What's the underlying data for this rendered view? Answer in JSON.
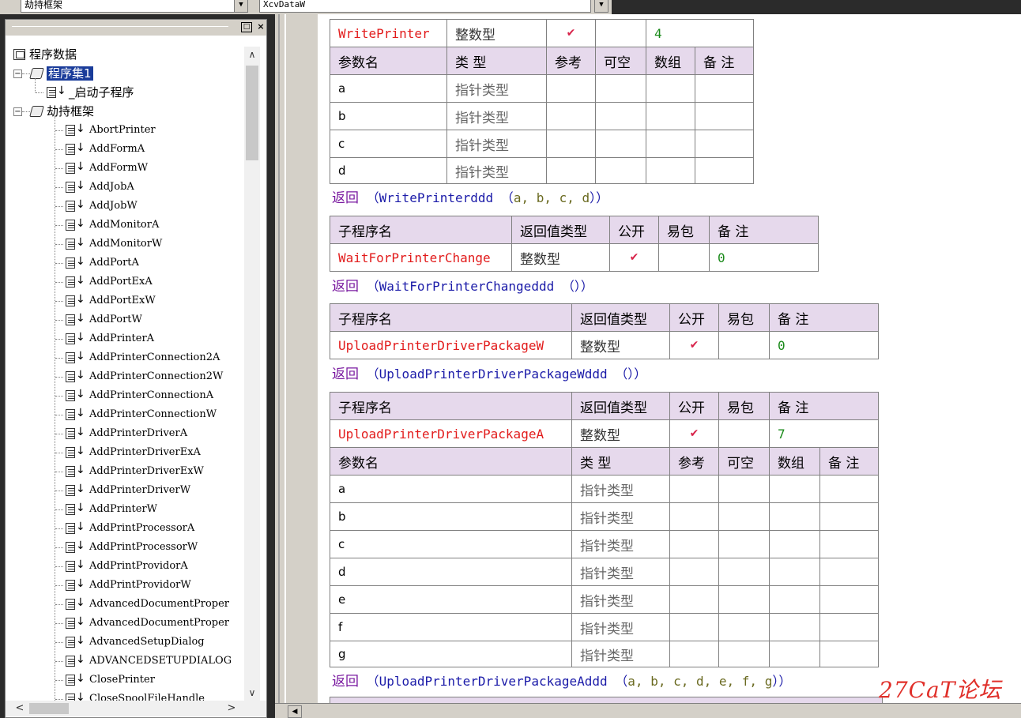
{
  "topbar": {
    "module_combo": "劫持框架",
    "sub_combo": "XcvDataW"
  },
  "tree": {
    "root": "程序数据",
    "set1": "程序集1",
    "set1_child": "_启动子程序",
    "module": "劫持框架",
    "items": [
      "AbortPrinter",
      "AddFormA",
      "AddFormW",
      "AddJobA",
      "AddJobW",
      "AddMonitorA",
      "AddMonitorW",
      "AddPortA",
      "AddPortExA",
      "AddPortExW",
      "AddPortW",
      "AddPrinterA",
      "AddPrinterConnection2A",
      "AddPrinterConnection2W",
      "AddPrinterConnectionA",
      "AddPrinterConnectionW",
      "AddPrinterDriverA",
      "AddPrinterDriverExA",
      "AddPrinterDriverExW",
      "AddPrinterDriverW",
      "AddPrinterW",
      "AddPrintProcessorA",
      "AddPrintProcessorW",
      "AddPrintProvidorA",
      "AddPrintProvidorW",
      "AdvancedDocumentProper",
      "AdvancedDocumentProper",
      "AdvancedSetupDialog",
      "ADVANCEDSETUPDIALOG",
      "ClosePrinter",
      "CloseSpoolFileHandle"
    ]
  },
  "headers": {
    "sub_name": "子程序名",
    "ret_type": "返回值类型",
    "public": "公开",
    "easy_pack": "易包",
    "note": "备 注",
    "param_name": "参数名",
    "type": "类 型",
    "ref": "参考",
    "nullable": "可空",
    "array": "数组"
  },
  "check": "✔",
  "int_type": "整数型",
  "ptr_type": "指针类型",
  "return_kw": "返回",
  "block0": {
    "name": "WritePrinter",
    "note": "4",
    "params": [
      "a",
      "b",
      "c",
      "d"
    ],
    "ret_fn": "WritePrinterddd",
    "ret_args": "a, b, c, d"
  },
  "block1": {
    "name": "WaitForPrinterChange",
    "note": "0",
    "ret_fn": "WaitForPrinterChangeddd"
  },
  "block2": {
    "name": "UploadPrinterDriverPackageW",
    "note": "0",
    "ret_fn": "UploadPrinterDriverPackageWddd"
  },
  "block3": {
    "name": "UploadPrinterDriverPackageA",
    "note": "7",
    "params": [
      "a",
      "b",
      "c",
      "d",
      "e",
      "f",
      "g"
    ],
    "ret_fn": "UploadPrinterDriverPackageAddd",
    "ret_args": "a, b, c, d, e, f, g"
  },
  "watermark": "27CaT论坛"
}
